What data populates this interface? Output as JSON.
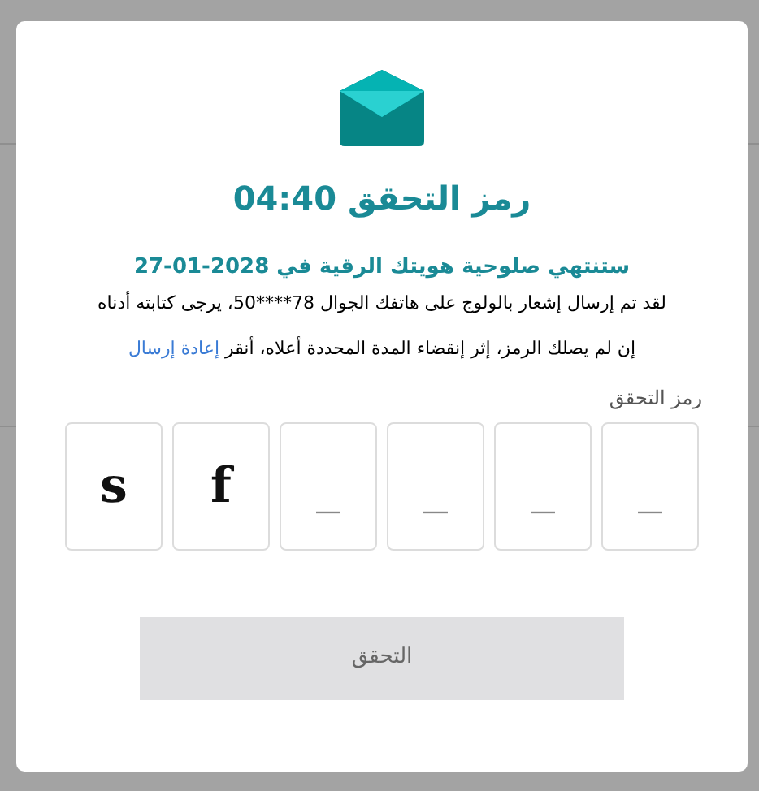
{
  "dialog": {
    "title": "رمز التحقق 04:40",
    "expiry": "ستنتهي صلوحية هويتك الرقية في 2028-01-27",
    "message": "لقد تم إرسال إشعار بالولوج على هاتفك الجوال 78****50، يرجى كتابته أدناه",
    "resend_text": "إن لم يصلك الرمز، إثر إنقضاء المدة المحددة أعلاه، أنقر",
    "resend_link": "إعادة إرسال",
    "code_label": "رمز التحقق",
    "code_boxes": [
      {
        "placeholder": "_"
      },
      {
        "placeholder": "_"
      },
      {
        "placeholder": "_"
      },
      {
        "placeholder": "_"
      },
      {
        "value": "f"
      },
      {
        "value": "s"
      }
    ],
    "submit": {
      "label": "التحقق",
      "disabled": true
    }
  }
}
